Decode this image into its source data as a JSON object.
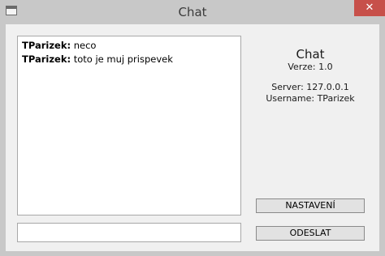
{
  "window": {
    "title": "Chat",
    "close_label": "✕"
  },
  "chat": {
    "messages": [
      {
        "author": "TParizek:",
        "text": " neco"
      },
      {
        "author": "TParizek:",
        "text": " toto je muj prispevek"
      }
    ]
  },
  "info": {
    "title": "Chat",
    "version": "Verze: 1.0",
    "server": "Server: 127.0.0.1",
    "username": "Username: TParizek"
  },
  "buttons": {
    "settings_label": "NASTAVENÍ",
    "send_label": "ODESLAT"
  },
  "input": {
    "value": "",
    "placeholder": ""
  },
  "colors": {
    "close_button": "#c7504a",
    "frame": "#c8c8c8"
  }
}
